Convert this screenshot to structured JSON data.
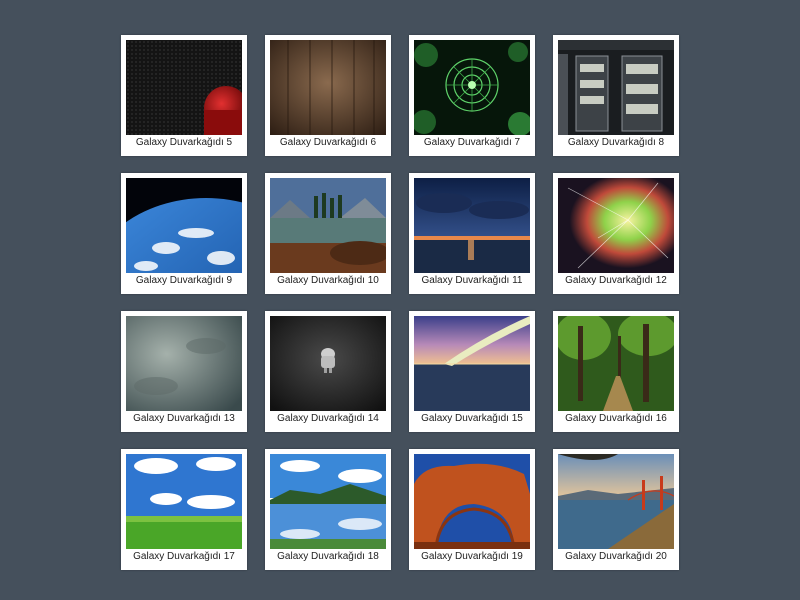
{
  "wallpapers": [
    {
      "label": "Galaxy Duvarkağıdı 5",
      "subject": "black carbon with red android"
    },
    {
      "label": "Galaxy Duvarkağıdı 6",
      "subject": "wood planks"
    },
    {
      "label": "Galaxy Duvarkağıdı 7",
      "subject": "green fractal"
    },
    {
      "label": "Galaxy Duvarkağıdı 8",
      "subject": "server room"
    },
    {
      "label": "Galaxy Duvarkağıdı 9",
      "subject": "earth from space"
    },
    {
      "label": "Galaxy Duvarkağıdı 10",
      "subject": "mountain lake"
    },
    {
      "label": "Galaxy Duvarkağıdı 11",
      "subject": "stormy sunset sea"
    },
    {
      "label": "Galaxy Duvarkağıdı 12",
      "subject": "shattered glass colorful logo"
    },
    {
      "label": "Galaxy Duvarkağıdı 13",
      "subject": "grunge texture"
    },
    {
      "label": "Galaxy Duvarkağıdı 14",
      "subject": "dark android figure"
    },
    {
      "label": "Galaxy Duvarkağıdı 15",
      "subject": "bridge at dusk"
    },
    {
      "label": "Galaxy Duvarkağıdı 16",
      "subject": "forest path"
    },
    {
      "label": "Galaxy Duvarkağıdı 17",
      "subject": "green field blue sky"
    },
    {
      "label": "Galaxy Duvarkağıdı 18",
      "subject": "lake reflection clouds"
    },
    {
      "label": "Galaxy Duvarkağıdı 19",
      "subject": "red rock arch"
    },
    {
      "label": "Galaxy Duvarkağıdı 20",
      "subject": "golden gate bay"
    }
  ]
}
